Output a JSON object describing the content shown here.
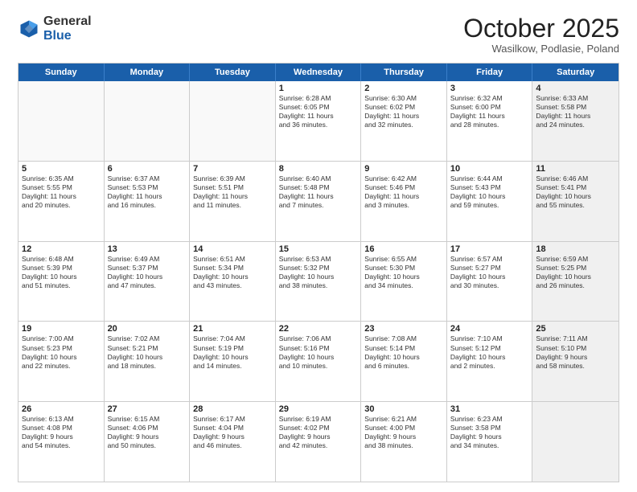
{
  "header": {
    "logo_general": "General",
    "logo_blue": "Blue",
    "month_title": "October 2025",
    "subtitle": "Wasilkow, Podlasie, Poland"
  },
  "weekdays": [
    "Sunday",
    "Monday",
    "Tuesday",
    "Wednesday",
    "Thursday",
    "Friday",
    "Saturday"
  ],
  "rows": [
    [
      {
        "day": "",
        "text": "",
        "empty": true
      },
      {
        "day": "",
        "text": "",
        "empty": true
      },
      {
        "day": "",
        "text": "",
        "empty": true
      },
      {
        "day": "1",
        "text": "Sunrise: 6:28 AM\nSunset: 6:05 PM\nDaylight: 11 hours\nand 36 minutes."
      },
      {
        "day": "2",
        "text": "Sunrise: 6:30 AM\nSunset: 6:02 PM\nDaylight: 11 hours\nand 32 minutes."
      },
      {
        "day": "3",
        "text": "Sunrise: 6:32 AM\nSunset: 6:00 PM\nDaylight: 11 hours\nand 28 minutes."
      },
      {
        "day": "4",
        "text": "Sunrise: 6:33 AM\nSunset: 5:58 PM\nDaylight: 11 hours\nand 24 minutes.",
        "shaded": true
      }
    ],
    [
      {
        "day": "5",
        "text": "Sunrise: 6:35 AM\nSunset: 5:55 PM\nDaylight: 11 hours\nand 20 minutes."
      },
      {
        "day": "6",
        "text": "Sunrise: 6:37 AM\nSunset: 5:53 PM\nDaylight: 11 hours\nand 16 minutes."
      },
      {
        "day": "7",
        "text": "Sunrise: 6:39 AM\nSunset: 5:51 PM\nDaylight: 11 hours\nand 11 minutes."
      },
      {
        "day": "8",
        "text": "Sunrise: 6:40 AM\nSunset: 5:48 PM\nDaylight: 11 hours\nand 7 minutes."
      },
      {
        "day": "9",
        "text": "Sunrise: 6:42 AM\nSunset: 5:46 PM\nDaylight: 11 hours\nand 3 minutes."
      },
      {
        "day": "10",
        "text": "Sunrise: 6:44 AM\nSunset: 5:43 PM\nDaylight: 10 hours\nand 59 minutes."
      },
      {
        "day": "11",
        "text": "Sunrise: 6:46 AM\nSunset: 5:41 PM\nDaylight: 10 hours\nand 55 minutes.",
        "shaded": true
      }
    ],
    [
      {
        "day": "12",
        "text": "Sunrise: 6:48 AM\nSunset: 5:39 PM\nDaylight: 10 hours\nand 51 minutes."
      },
      {
        "day": "13",
        "text": "Sunrise: 6:49 AM\nSunset: 5:37 PM\nDaylight: 10 hours\nand 47 minutes."
      },
      {
        "day": "14",
        "text": "Sunrise: 6:51 AM\nSunset: 5:34 PM\nDaylight: 10 hours\nand 43 minutes."
      },
      {
        "day": "15",
        "text": "Sunrise: 6:53 AM\nSunset: 5:32 PM\nDaylight: 10 hours\nand 38 minutes."
      },
      {
        "day": "16",
        "text": "Sunrise: 6:55 AM\nSunset: 5:30 PM\nDaylight: 10 hours\nand 34 minutes."
      },
      {
        "day": "17",
        "text": "Sunrise: 6:57 AM\nSunset: 5:27 PM\nDaylight: 10 hours\nand 30 minutes."
      },
      {
        "day": "18",
        "text": "Sunrise: 6:59 AM\nSunset: 5:25 PM\nDaylight: 10 hours\nand 26 minutes.",
        "shaded": true
      }
    ],
    [
      {
        "day": "19",
        "text": "Sunrise: 7:00 AM\nSunset: 5:23 PM\nDaylight: 10 hours\nand 22 minutes."
      },
      {
        "day": "20",
        "text": "Sunrise: 7:02 AM\nSunset: 5:21 PM\nDaylight: 10 hours\nand 18 minutes."
      },
      {
        "day": "21",
        "text": "Sunrise: 7:04 AM\nSunset: 5:19 PM\nDaylight: 10 hours\nand 14 minutes."
      },
      {
        "day": "22",
        "text": "Sunrise: 7:06 AM\nSunset: 5:16 PM\nDaylight: 10 hours\nand 10 minutes."
      },
      {
        "day": "23",
        "text": "Sunrise: 7:08 AM\nSunset: 5:14 PM\nDaylight: 10 hours\nand 6 minutes."
      },
      {
        "day": "24",
        "text": "Sunrise: 7:10 AM\nSunset: 5:12 PM\nDaylight: 10 hours\nand 2 minutes."
      },
      {
        "day": "25",
        "text": "Sunrise: 7:11 AM\nSunset: 5:10 PM\nDaylight: 9 hours\nand 58 minutes.",
        "shaded": true
      }
    ],
    [
      {
        "day": "26",
        "text": "Sunrise: 6:13 AM\nSunset: 4:08 PM\nDaylight: 9 hours\nand 54 minutes."
      },
      {
        "day": "27",
        "text": "Sunrise: 6:15 AM\nSunset: 4:06 PM\nDaylight: 9 hours\nand 50 minutes."
      },
      {
        "day": "28",
        "text": "Sunrise: 6:17 AM\nSunset: 4:04 PM\nDaylight: 9 hours\nand 46 minutes."
      },
      {
        "day": "29",
        "text": "Sunrise: 6:19 AM\nSunset: 4:02 PM\nDaylight: 9 hours\nand 42 minutes."
      },
      {
        "day": "30",
        "text": "Sunrise: 6:21 AM\nSunset: 4:00 PM\nDaylight: 9 hours\nand 38 minutes."
      },
      {
        "day": "31",
        "text": "Sunrise: 6:23 AM\nSunset: 3:58 PM\nDaylight: 9 hours\nand 34 minutes."
      },
      {
        "day": "",
        "text": "",
        "empty": true,
        "shaded": true
      }
    ]
  ]
}
